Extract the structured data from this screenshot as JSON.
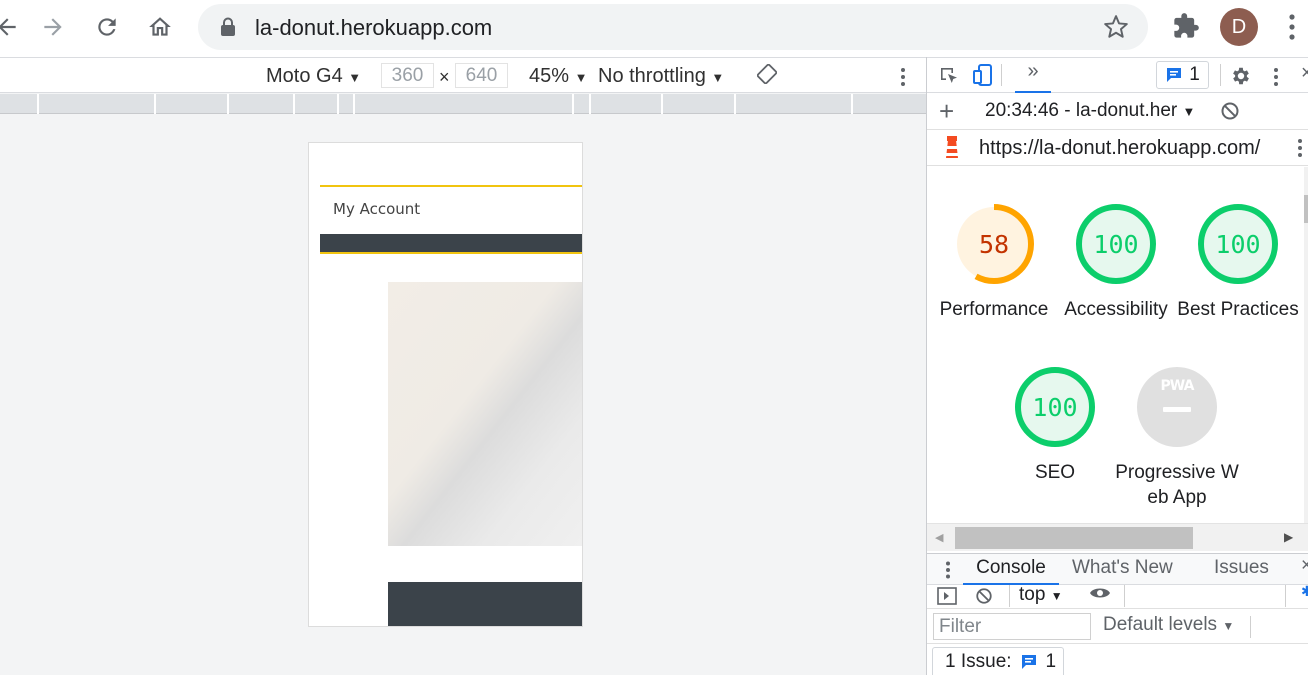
{
  "browser": {
    "url": "la-donut.herokuapp.com",
    "avatar_letter": "D",
    "icons": [
      "back-icon",
      "forward-icon",
      "reload-icon",
      "home-icon",
      "lock-icon",
      "star-icon",
      "extensions-icon",
      "menu-icon"
    ]
  },
  "device_toolbar": {
    "device": "Moto G4",
    "width": "360",
    "times": "×",
    "height": "640",
    "zoom": "45%",
    "throttling": "No throttling"
  },
  "page": {
    "my_account": "My Account",
    "accent_color": "#f1c40f",
    "dark_color": "#3b434a"
  },
  "devtools": {
    "issues_count": "1",
    "report_time": "20:34:46 - la-donut.her",
    "report_url": "https://la-donut.herokuapp.com/",
    "gauges": [
      {
        "score": "58",
        "label": "Performance",
        "value": 0.58,
        "color": "#ffa400",
        "bg": "#fff3e0"
      },
      {
        "score": "100",
        "label": "Accessibility",
        "value": 1.0,
        "color": "#0cce6b",
        "bg": "#e6f8ee"
      },
      {
        "score": "100",
        "label": "Best Practices",
        "value": 1.0,
        "color": "#0cce6b",
        "bg": "#e6f8ee"
      },
      {
        "score": "100",
        "label": "SEO",
        "value": 1.0,
        "color": "#0cce6b",
        "bg": "#e6f8ee"
      },
      {
        "score": "",
        "label": "Progressive Web App",
        "badge": "PWA",
        "color": "#cccccc",
        "bg": "#e0e0e0"
      }
    ],
    "drawer_tabs": [
      "Console",
      "What's New",
      "Issues"
    ],
    "context": "top",
    "filter_placeholder": "Filter",
    "levels": "Default levels",
    "issue_label": "1 Issue:",
    "issue_count": "1"
  }
}
